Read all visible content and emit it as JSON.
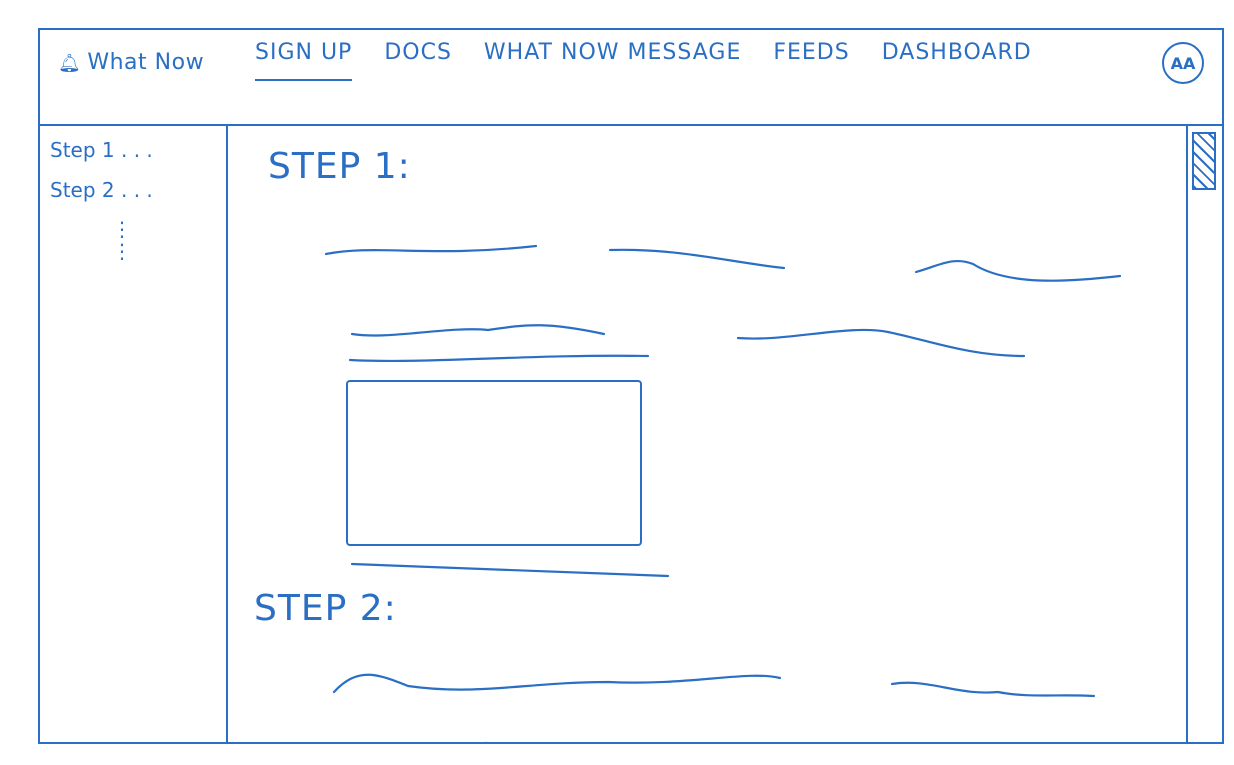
{
  "brand": {
    "name": "What Now",
    "icon": "bell-icon"
  },
  "nav": {
    "items": [
      {
        "label": "SIGN UP",
        "active": true
      },
      {
        "label": "DOCS",
        "active": false
      },
      {
        "label": "WHAT NOW MESSAGE",
        "active": false
      },
      {
        "label": "FEEDS",
        "active": false
      },
      {
        "label": "DASHBOARD",
        "active": false
      }
    ]
  },
  "avatar": {
    "initials": "AA"
  },
  "sidebar": {
    "items": [
      {
        "label": "Step 1 . . ."
      },
      {
        "label": "Step 2 . . ."
      }
    ],
    "more": "⋮"
  },
  "main": {
    "step1_title": "STEP 1:",
    "step2_title": "STEP 2:"
  },
  "accent_color": "#2a6fc4"
}
